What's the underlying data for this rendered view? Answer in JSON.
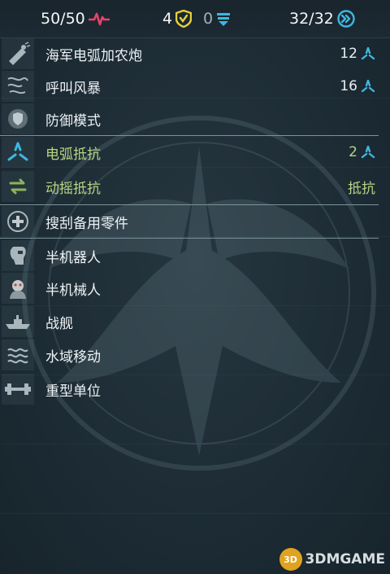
{
  "topbar": {
    "health": "50/50",
    "armor": "4",
    "shield": "0",
    "move": "32/32"
  },
  "abilities": [
    {
      "name": "海军电弧加农炮",
      "value": "12",
      "icon": "cannon-icon",
      "value_icon": "arc-damage-icon"
    },
    {
      "name": "呼叫风暴",
      "value": "16",
      "icon": "storm-icon",
      "value_icon": "arc-damage-icon"
    },
    {
      "name": "防御模式",
      "value": "",
      "icon": "defense-shield-icon"
    },
    {
      "name": "电弧抵抗",
      "value": "2",
      "icon": "arc-resist-icon",
      "value_icon": "arc-damage-icon"
    },
    {
      "name": "动摇抵抗",
      "value": "抵抗",
      "icon": "morale-resist-icon"
    },
    {
      "name": "搜刮备用零件",
      "value": "",
      "icon": "repair-icon"
    }
  ],
  "traits": [
    {
      "name": "半机器人",
      "icon": "cyborg-icon"
    },
    {
      "name": "半机械人",
      "icon": "android-icon"
    },
    {
      "name": "战舰",
      "icon": "warship-icon"
    },
    {
      "name": "水域移动",
      "icon": "water-waves-icon"
    },
    {
      "name": "重型单位",
      "icon": "heavy-dumbbell-icon"
    }
  ],
  "colors": {
    "health": "#e8436b",
    "armor": "#e5d13a",
    "shield": "#3fb6e0",
    "move": "#3fb6e0",
    "resist_text": "#b7d483",
    "separator": "#7c939c"
  },
  "watermark": {
    "logo_text": "3D",
    "text": "3DMGAME"
  }
}
